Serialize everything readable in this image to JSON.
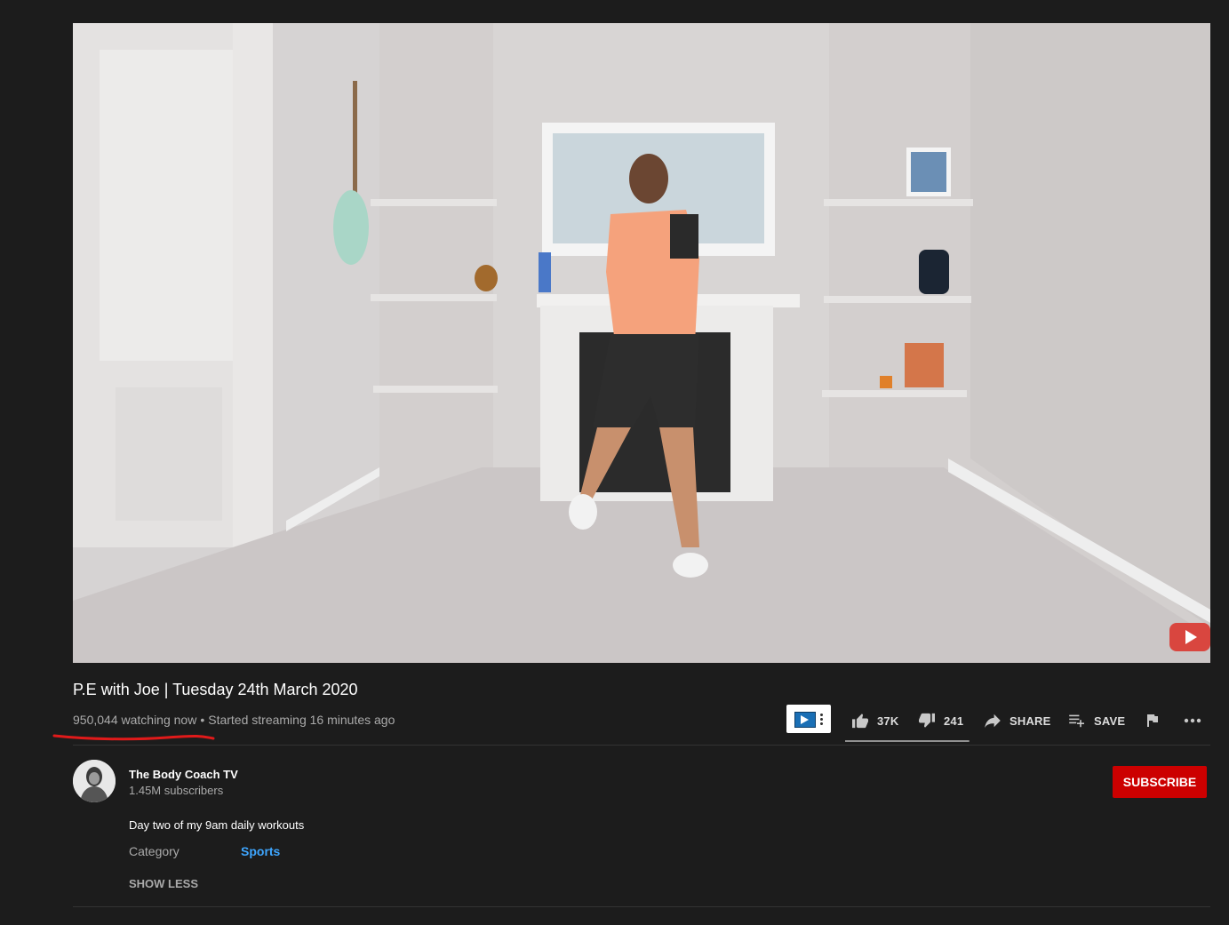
{
  "video": {
    "title": "P.E with Joe | Tuesday 24th March 2020",
    "watching": "950,044 watching now",
    "separator": "•",
    "started": "Started streaming 16 minutes ago",
    "likes_ratio": 0.993
  },
  "actions": {
    "likes": "37K",
    "dislikes": "241",
    "share": "SHARE",
    "save": "SAVE"
  },
  "channel": {
    "name": "The Body Coach TV",
    "subscribers": "1.45M subscribers",
    "subscribe_label": "SUBSCRIBE"
  },
  "description": {
    "text": "Day two of my 9am daily workouts",
    "category_label": "Category",
    "category_value": "Sports",
    "show_less": "SHOW LESS"
  },
  "colors": {
    "background": "#1c1c1c",
    "subscribe": "#cc0000",
    "link": "#3ea6ff",
    "annotation": "#e01a1a"
  }
}
